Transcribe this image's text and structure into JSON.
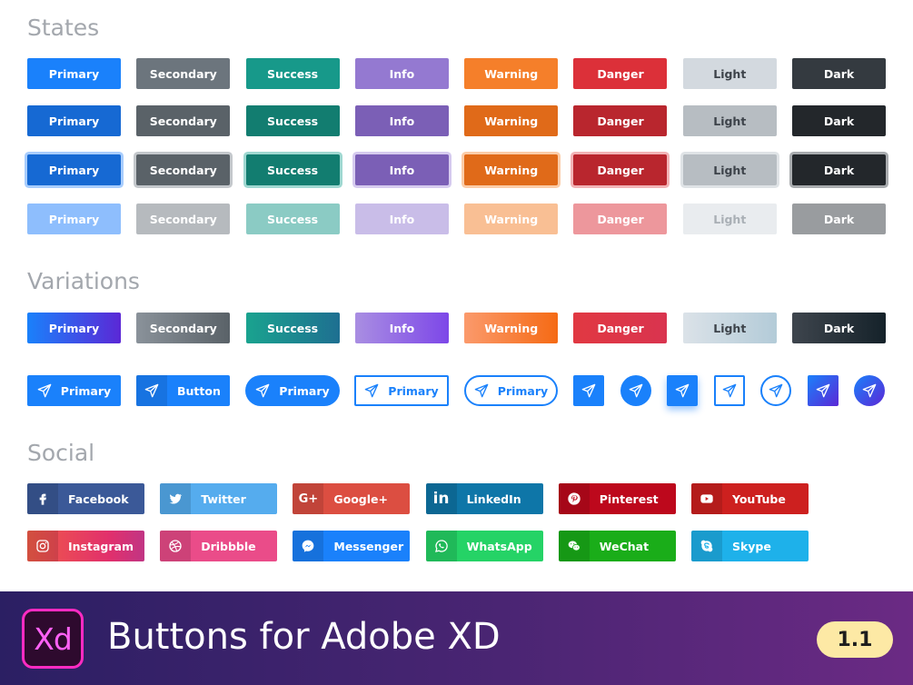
{
  "sections": {
    "states": "States",
    "variations": "Variations",
    "social": "Social"
  },
  "labels": [
    "Primary",
    "Secondary",
    "Success",
    "Info",
    "Warning",
    "Danger",
    "Light",
    "Dark"
  ],
  "colors": {
    "default": [
      "#1a81fb",
      "#6c757d",
      "#17998a",
      "#9479d1",
      "#f57f2a",
      "#dc3039",
      "#d3d9df",
      "#343a40"
    ],
    "hover": [
      "#1669d3",
      "#5a6268",
      "#127d70",
      "#7b5fb6",
      "#e06a19",
      "#b9262e",
      "#b7bdc2",
      "#23272b"
    ],
    "disabled": [
      "#8ebefd",
      "#b6babe",
      "#8bcbc4",
      "#c9bde8",
      "#f9bf94",
      "#ed979c",
      "#e9ecef",
      "#999c9f"
    ]
  },
  "icon_buttons": {
    "primary": "Primary",
    "button": "Button"
  },
  "social": {
    "row1": [
      {
        "label": "Facebook",
        "color": "#3b5998",
        "icon": "facebook-icon"
      },
      {
        "label": "Twitter",
        "color": "#55acee",
        "icon": "twitter-icon"
      },
      {
        "label": "Google+",
        "color": "#dc4e41",
        "icon": "google-plus-icon"
      },
      {
        "label": "LinkedIn",
        "color": "#0e76a8",
        "icon": "linkedin-icon"
      },
      {
        "label": "Pinterest",
        "color": "#bd081c",
        "icon": "pinterest-icon"
      },
      {
        "label": "YouTube",
        "color": "#cd201f",
        "icon": "youtube-icon"
      }
    ],
    "row2": [
      {
        "label": "Instagram",
        "color": "#e8405f",
        "icon": "instagram-icon"
      },
      {
        "label": "Dribbble",
        "color": "#ea4c89",
        "icon": "dribbble-icon"
      },
      {
        "label": "Messenger",
        "color": "#1a81fb",
        "icon": "messenger-icon"
      },
      {
        "label": "WhatsApp",
        "color": "#25d366",
        "icon": "whatsapp-icon"
      },
      {
        "label": "WeChat",
        "color": "#1aad19",
        "icon": "wechat-icon"
      },
      {
        "label": "Skype",
        "color": "#1eb1ea",
        "icon": "skype-icon"
      }
    ]
  },
  "footer": {
    "logo_text": "Xd",
    "title": "Buttons for Adobe XD",
    "version": "1.1"
  }
}
